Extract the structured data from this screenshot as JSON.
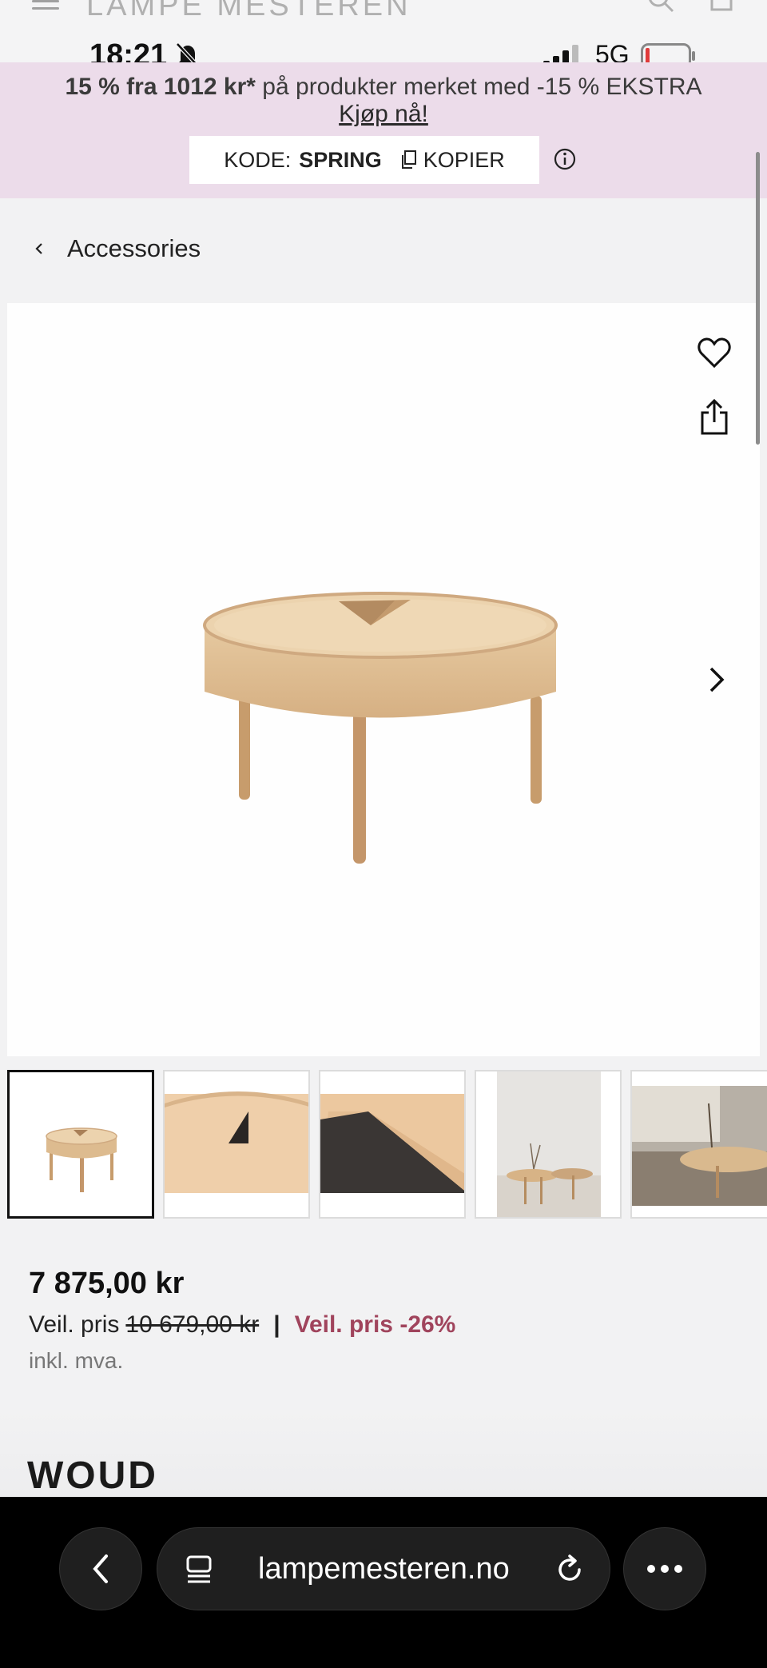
{
  "site": {
    "logo_text": "LAMPE MESTEREN"
  },
  "status_bar": {
    "time": "18:21",
    "network": "5G"
  },
  "promo": {
    "highlight": "15 % fra 1012 kr*",
    "rest": " på produkter merket med -15 % EKSTRA",
    "link": "Kjøp nå!",
    "code_label": "KODE:",
    "code_value": "SPRING",
    "copy_label": "KOPIER"
  },
  "breadcrumb": {
    "label": "Accessories"
  },
  "product": {
    "price": "7 875,00 kr",
    "reference_label": "Veil. pris",
    "reference_price": "10 679,00 kr",
    "separator": "|",
    "discount": "Veil. pris -26%",
    "vat": "inkl. mva.",
    "brand": "WOUD"
  },
  "browser": {
    "url": "lampemesteren.no"
  },
  "icons": [
    "hamburger-icon",
    "search-icon",
    "bag-icon",
    "bell-off-icon",
    "signal-icon",
    "battery-icon",
    "copy-icon",
    "info-icon",
    "chevron-left-icon",
    "heart-icon",
    "share-icon",
    "chevron-right-icon",
    "tabs-icon",
    "reload-icon",
    "more-icon"
  ],
  "colors": {
    "promo_bg": "#ecdcea",
    "discount": "#a0445c",
    "browser_bg": "#000000"
  }
}
